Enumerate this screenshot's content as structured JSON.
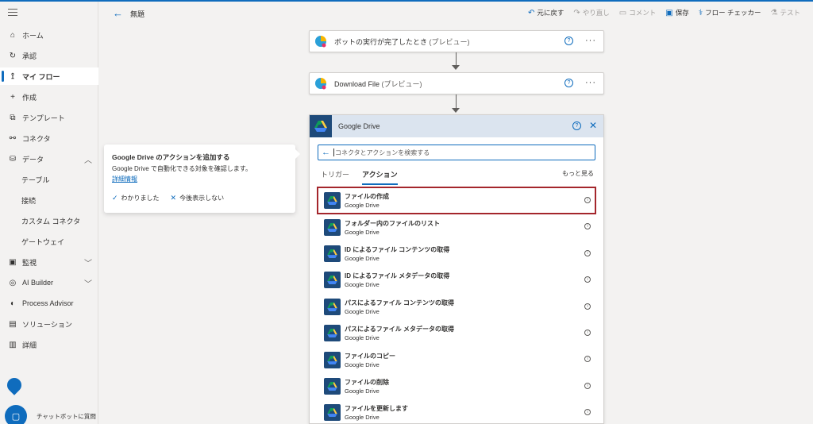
{
  "topbar": {
    "flow_title": "無題",
    "undo": "元に戻す",
    "redo": "やり直し",
    "comment": "コメント",
    "save": "保存",
    "flow_checker": "フロー チェッカー",
    "test": "テスト"
  },
  "sidebar": {
    "items": [
      {
        "label": "ホーム",
        "icon": "home-icon"
      },
      {
        "label": "承認",
        "icon": "approval-icon"
      },
      {
        "label": "マイ フロー",
        "icon": "flow-icon"
      },
      {
        "label": "作成",
        "icon": "plus-icon"
      },
      {
        "label": "テンプレート",
        "icon": "template-icon"
      },
      {
        "label": "コネクタ",
        "icon": "connector-icon"
      },
      {
        "label": "データ",
        "icon": "database-icon"
      },
      {
        "label": "テーブル"
      },
      {
        "label": "接続"
      },
      {
        "label": "カスタム コネクタ"
      },
      {
        "label": "ゲートウェイ"
      },
      {
        "label": "監視",
        "icon": "monitor-icon"
      },
      {
        "label": "AI Builder",
        "icon": "ai-builder-icon"
      },
      {
        "label": "Process Advisor",
        "icon": "process-advisor-icon"
      },
      {
        "label": "ソリューション",
        "icon": "solution-icon"
      },
      {
        "label": "詳細",
        "icon": "book-icon"
      }
    ],
    "chatbot_label": "チャットボットに質問"
  },
  "cards": {
    "trigger": {
      "title": "ボットの実行が完了したとき",
      "preview": "(プレビュー)"
    },
    "download": {
      "title": "Download File",
      "preview": "(プレビュー)"
    }
  },
  "panel": {
    "title": "Google Drive",
    "search_placeholder": "コネクタとアクションを検索する",
    "tabs": [
      "トリガー",
      "アクション"
    ],
    "see_more": "もっと見る",
    "actions": [
      {
        "name": "ファイルの作成",
        "connector": "Google Drive"
      },
      {
        "name": "フォルダー内のファイルのリスト",
        "connector": "Google Drive"
      },
      {
        "name": "ID によるファイル コンテンツの取得",
        "connector": "Google Drive"
      },
      {
        "name": "ID によるファイル メタデータの取得",
        "connector": "Google Drive"
      },
      {
        "name": "パスによるファイル コンテンツの取得",
        "connector": "Google Drive"
      },
      {
        "name": "パスによるファイル メタデータの取得",
        "connector": "Google Drive"
      },
      {
        "name": "ファイルのコピー",
        "connector": "Google Drive"
      },
      {
        "name": "ファイルの削除",
        "connector": "Google Drive"
      },
      {
        "name": "ファイルを更新します",
        "connector": "Google Drive"
      }
    ]
  },
  "callout": {
    "title": "Google Drive のアクションを追加する",
    "body": "Google Drive で自動化できる対象を確認します。",
    "link": "詳細情報",
    "ok": "わかりました",
    "dismiss": "今後表示しない"
  },
  "colors": {
    "accent": "#0f6cbd",
    "selection_outline": "#a4262c",
    "gd_header": "#dbe4ef"
  }
}
